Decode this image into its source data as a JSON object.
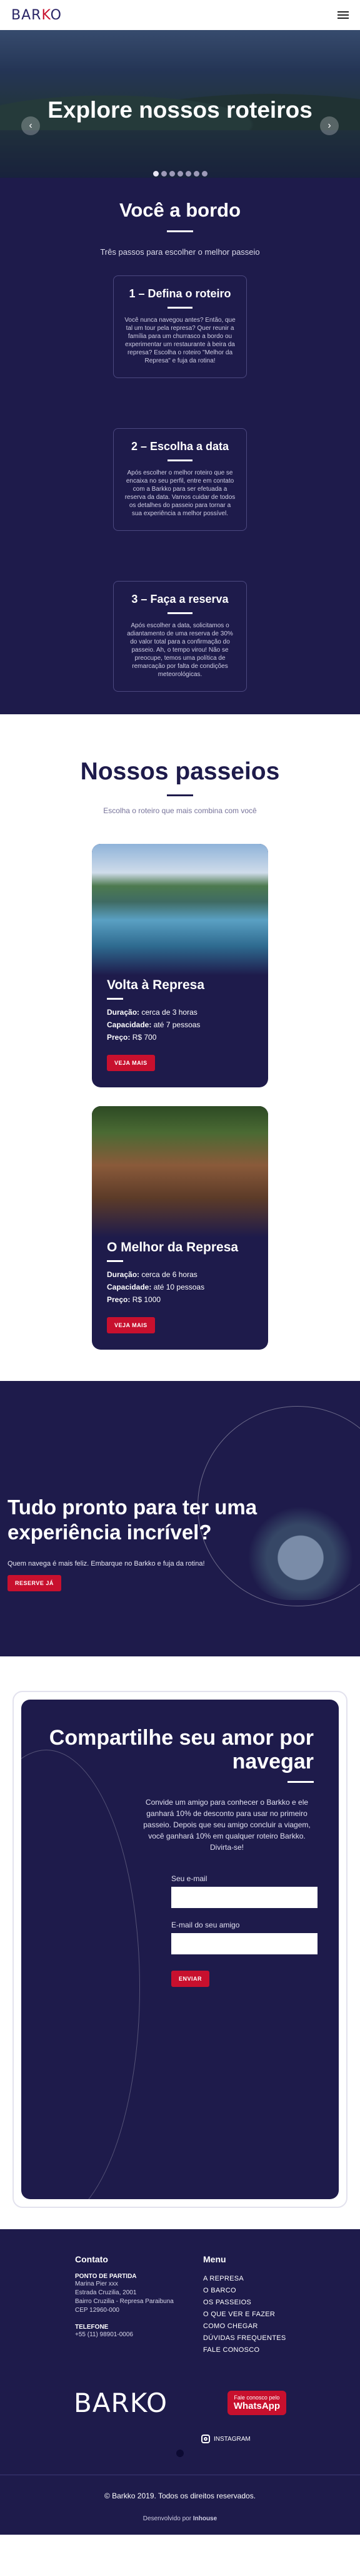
{
  "header": {
    "logo": "BARKO",
    "menu_icon": "hamburger-icon"
  },
  "hero": {
    "title": "Explore nossos roteiros",
    "prev_icon": "chevron-left-icon",
    "next_icon": "chevron-right-icon",
    "slides": 7,
    "active_slide": 1
  },
  "steps": {
    "title": "Você a bordo",
    "subtitle": "Três passos para escolher o melhor passeio",
    "items": [
      {
        "title": "1 – Defina o roteiro",
        "text": "Você nunca navegou antes? Então, que tal um tour pela represa? Quer reunir a família para um churrasco a bordo ou experimentar um restaurante à beira da represa? Escolha o roteiro \"Melhor da Represa\" e fuja da rotina!"
      },
      {
        "title": "2 – Escolha a data",
        "text": "Após escolher o melhor roteiro que se encaixa no seu perfil, entre em contato com a Barkko para ser efetuada a reserva da data. Vamos cuidar de todos os detalhes do passeio para tornar a sua experiência a melhor possível."
      },
      {
        "title": "3 – Faça a reserva",
        "text": "Após escolher a data, solicitamos o adiantamento de uma reserva de 30% do valor total para a confirmação do passeio. Ah, o tempo virou! Não se preocupe, temos uma política de remarcação por falta de condições meteorológicas."
      }
    ]
  },
  "passeios": {
    "title": "Nossos passeios",
    "subtitle": "Escolha o roteiro que mais combina com você",
    "tours": [
      {
        "name": "Volta à Represa",
        "duration_label": "Duração:",
        "duration": "cerca de 3 horas",
        "capacity_label": "Capacidade:",
        "capacity": "até 7 pessoas",
        "price_label": "Preço:",
        "price": "R$ 700",
        "button": "VEJA MAIS"
      },
      {
        "name": "O Melhor da Represa",
        "duration_label": "Duração:",
        "duration": "cerca de 6 horas",
        "capacity_label": "Capacidade:",
        "capacity": "até 10 pessoas",
        "price_label": "Preço:",
        "price": "R$ 1000",
        "button": "VEJA MAIS"
      }
    ]
  },
  "cta": {
    "title": "Tudo pronto para ter uma experiência incrível?",
    "text": "Quem navega é mais feliz. Embarque no Barkko e fuja da rotina!",
    "button": "RESERVE JÁ"
  },
  "share": {
    "title": "Compartilhe seu amor por navegar",
    "text": "Convide um amigo para conhecer o Barkko e ele ganhará 10% de desconto para usar no primeiro passeio. Depois que seu amigo concluir a viagem, você ganhará 10% em qualquer roteiro Barkko. Divirta-se!",
    "email_label": "Seu e-mail",
    "friend_email_label": "E-mail do seu amigo",
    "button": "ENVIAR"
  },
  "footer": {
    "contact_title": "Contato",
    "departure_label": "PONTO DE PARTIDA",
    "address_lines": [
      "Marina Pier xxx",
      "Estrada Cruzilia, 2001",
      "Bairro Cruzilia - Represa Paraibuna",
      "CEP 12960-000"
    ],
    "phone_label": "TELEFONE",
    "phone": "+55 (11) 98901-0006",
    "menu_title": "Menu",
    "menu_items": [
      "A REPRESA",
      "O BARCO",
      "OS PASSEIOS",
      "O QUE VER E FAZER",
      "COMO CHEGAR",
      "DÚVIDAS FREQUENTES",
      "FALE CONOSCO"
    ],
    "logo": "BARKO",
    "whatsapp_top": "Fale conosco pelo",
    "whatsapp_main": "WhatsApp",
    "instagram": "INSTAGRAM",
    "copyright": "© Barkko 2019. Todos os direitos reservados.",
    "developed_by": "Desenvolvido por",
    "developer": "Inhouse"
  },
  "colors": {
    "navy": "#1e1b4b",
    "accent_red": "#c8102e",
    "white": "#ffffff"
  }
}
